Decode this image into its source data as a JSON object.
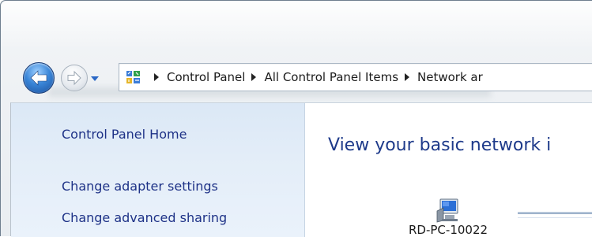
{
  "window": {
    "accent": "#3a86d8",
    "sidebar_bg": "#dbe8f6"
  },
  "navigation": {
    "back_icon": "back-arrow-icon",
    "forward_icon": "forward-arrow-icon",
    "recent_icon": "chevron-down-icon"
  },
  "address_bar": {
    "icon": "control-panel-icon",
    "crumbs": [
      "Control Panel",
      "All Control Panel Items",
      "Network ar"
    ]
  },
  "sidebar": {
    "items": [
      {
        "label": "Control Panel Home"
      },
      {
        "label": "Change adapter settings"
      },
      {
        "label": "Change advanced sharing"
      }
    ]
  },
  "main": {
    "title": "View your basic network i",
    "computer_name": "RD-PC-10022"
  }
}
